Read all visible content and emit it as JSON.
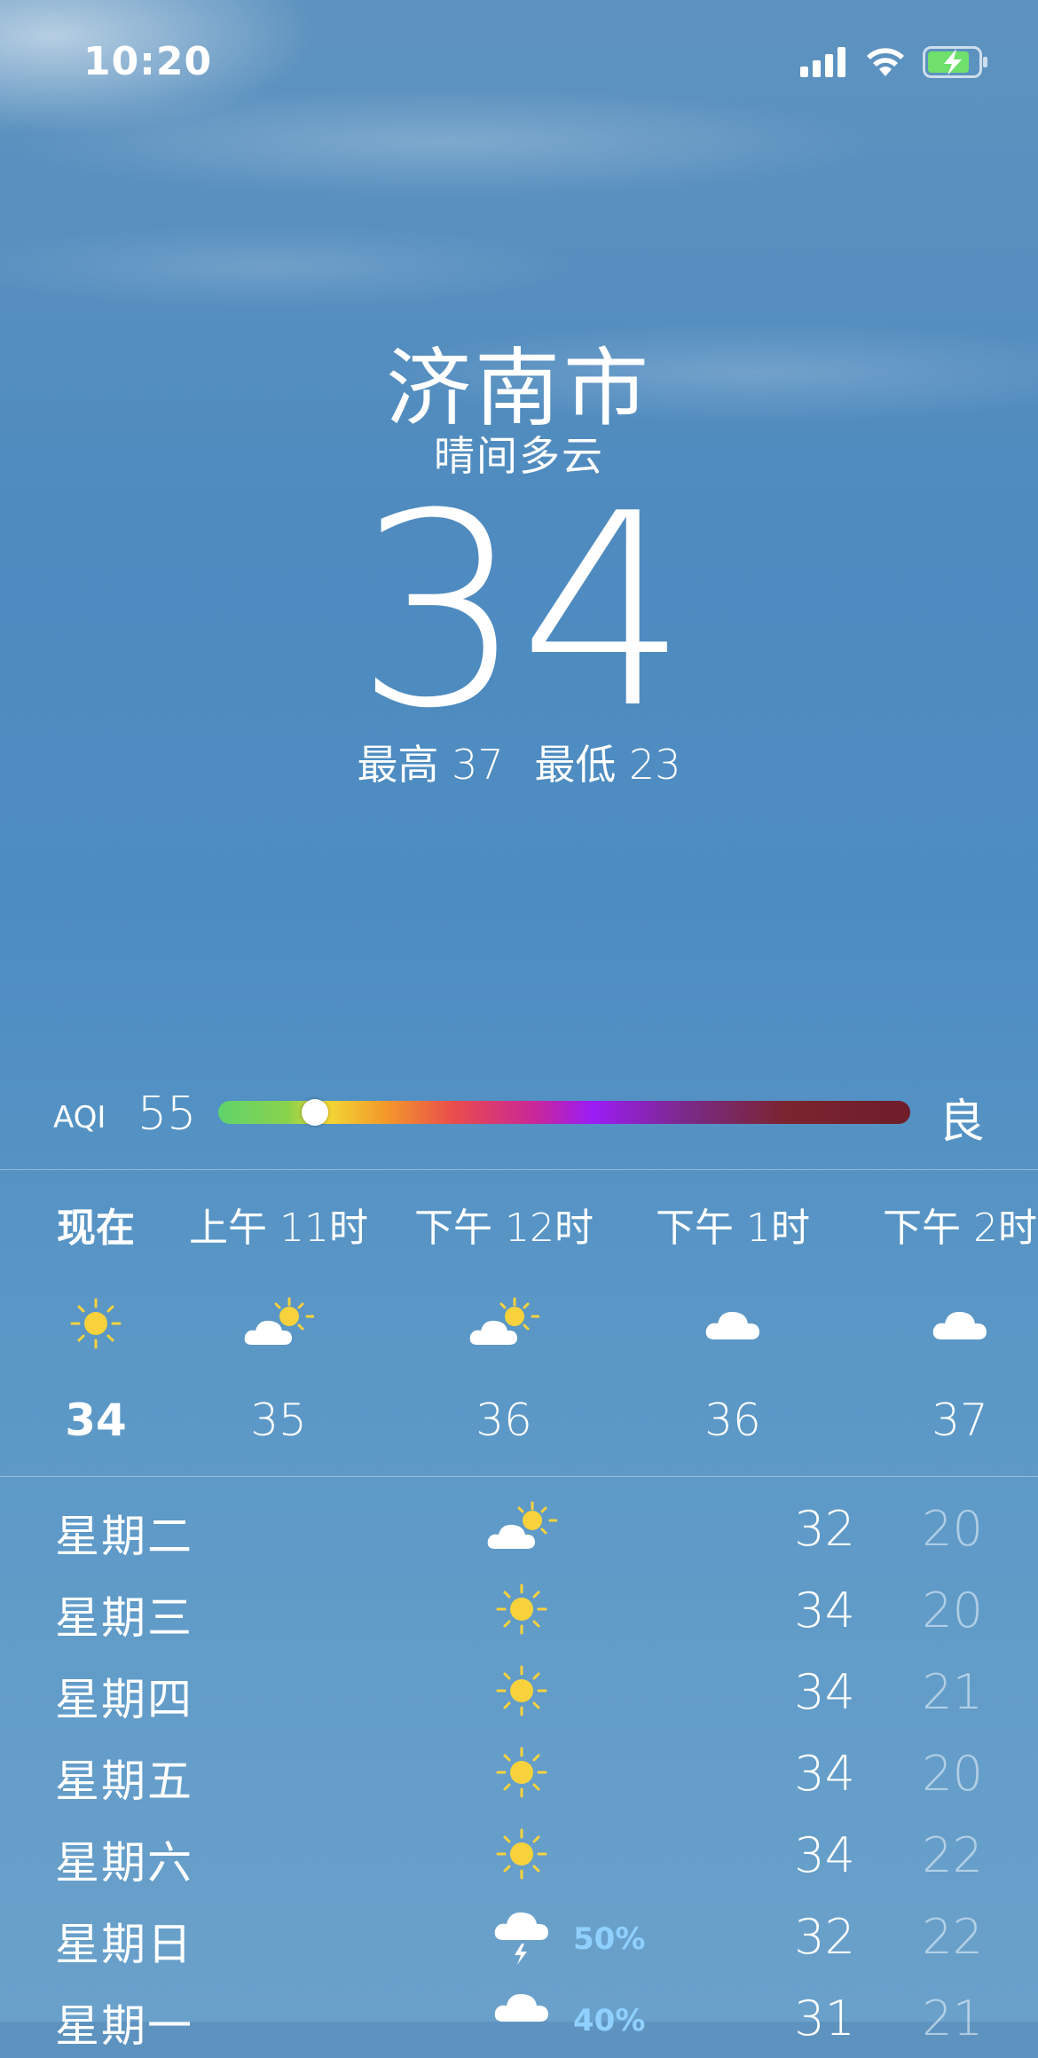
{
  "status_bar": {
    "time": "10:20",
    "icons": [
      "signal-icon",
      "wifi-icon",
      "battery-charging-icon"
    ]
  },
  "header": {
    "city": "济南市",
    "condition": "晴间多云",
    "temperature": "34",
    "high": "最高 37",
    "low": "最低 23"
  },
  "aqi": {
    "label": "AQI",
    "value": "55",
    "grade": "良",
    "level_fraction": 0.14
  },
  "hourly": [
    {
      "time": "现在",
      "icon": "sun-icon",
      "temp": "34"
    },
    {
      "time": "上午 11时",
      "icon": "partly-cloudy-icon",
      "temp": "35"
    },
    {
      "time": "下午 12时",
      "icon": "partly-cloudy-icon",
      "temp": "36"
    },
    {
      "time": "下午 1时",
      "icon": "cloud-icon",
      "temp": "36"
    },
    {
      "time": "下午 2时",
      "icon": "cloud-icon",
      "temp": "37"
    }
  ],
  "daily": [
    {
      "day": "星期二",
      "icon": "partly-cloudy-icon",
      "precip": "",
      "high": "32",
      "low": "20"
    },
    {
      "day": "星期三",
      "icon": "sun-icon",
      "precip": "",
      "high": "34",
      "low": "20"
    },
    {
      "day": "星期四",
      "icon": "sun-icon",
      "precip": "",
      "high": "34",
      "low": "21"
    },
    {
      "day": "星期五",
      "icon": "sun-icon",
      "precip": "",
      "high": "34",
      "low": "20"
    },
    {
      "day": "星期六",
      "icon": "sun-icon",
      "precip": "",
      "high": "34",
      "low": "22"
    },
    {
      "day": "星期日",
      "icon": "thunderstorm-icon",
      "precip": "50%",
      "high": "32",
      "low": "22"
    },
    {
      "day": "星期一",
      "icon": "rain-cloud-icon",
      "precip": "40%",
      "high": "31",
      "low": "21"
    }
  ],
  "colors": {
    "sun": "#f7d23c",
    "precip": "#8fd0ff",
    "battery": "#6ee06b"
  }
}
